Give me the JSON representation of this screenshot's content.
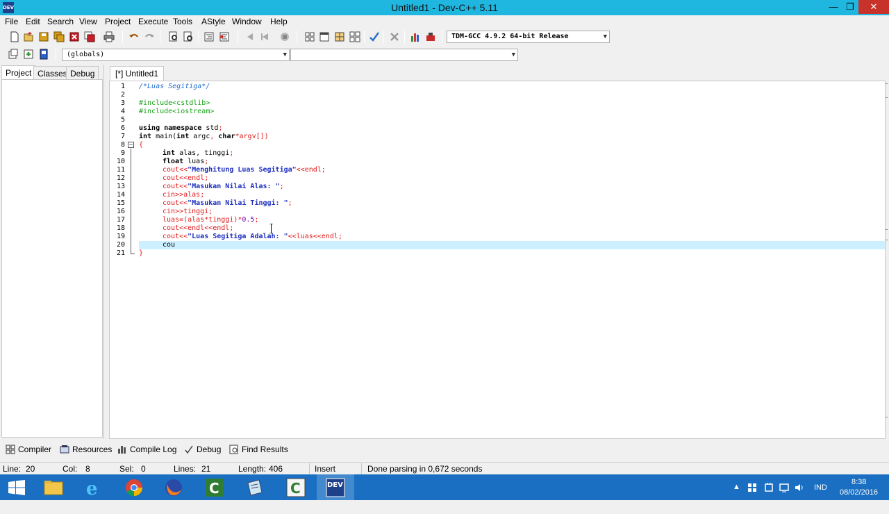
{
  "window": {
    "title": "Untitled1 - Dev-C++ 5.11",
    "icon_text": "DEV",
    "minimize_glyph": "—",
    "restore_glyph": "❐",
    "close_glyph": "✕"
  },
  "menu": [
    "File",
    "Edit",
    "Search",
    "View",
    "Project",
    "Execute",
    "Tools",
    "AStyle",
    "Window",
    "Help"
  ],
  "toolbar": {
    "compiler_select": "TDM-GCC 4.9.2 64-bit Release",
    "scope_select": "(globals)",
    "function_select": ""
  },
  "left_panel": {
    "tabs": [
      "Project",
      "Classes",
      "Debug"
    ],
    "active_tab": "Project"
  },
  "editor": {
    "tab_label": "[*] Untitled1",
    "current_line": 20,
    "lines": [
      {
        "n": "1"
      },
      {
        "n": "2"
      },
      {
        "n": "3"
      },
      {
        "n": "4"
      },
      {
        "n": "5"
      },
      {
        "n": "6"
      },
      {
        "n": "7"
      },
      {
        "n": "8"
      },
      {
        "n": "9"
      },
      {
        "n": "10"
      },
      {
        "n": "11"
      },
      {
        "n": "12"
      },
      {
        "n": "13"
      },
      {
        "n": "14"
      },
      {
        "n": "15"
      },
      {
        "n": "16"
      },
      {
        "n": "17"
      },
      {
        "n": "18"
      },
      {
        "n": "19"
      },
      {
        "n": "20"
      },
      {
        "n": "21"
      }
    ],
    "code": {
      "l1": "/*Luas Segitiga*/",
      "l3": "#include<cstdlib>",
      "l4": "#include<iostream>",
      "l6_kw": "using namespace",
      "l6_rest": " std",
      "l7_kw1": "int",
      "l7_a": " main(",
      "l7_kw2": "int",
      "l7_b": " argc",
      "l7_c": ", ",
      "l7_kw3": "char",
      "l7_d": "*argv[])",
      "l8": "{",
      "l9_kw": "int",
      "l9_rest": " alas, tinggi",
      "l10_kw": "float",
      "l10_rest": " luas",
      "l11_a": "cout<<",
      "l11_str": "\"Menghitung Luas Segitiga\"",
      "l11_b": "<<endl",
      "l12": "cout<<endl",
      "l13_a": "cout<<",
      "l13_str": "\"Masukan Nilai Alas: \"",
      "l14": "cin>>alas",
      "l15_a": "cout<<",
      "l15_str": "\"Masukan Nilai Tinggi: \"",
      "l16": "cin>>tinggi",
      "l17_a": "luas=(alas*tinggi)*",
      "l17_num": "0.5",
      "l18": "cout<<endl<<endl",
      "l19_a": "cout<<",
      "l19_str": "\"Luas Segitiga Adalah: \"",
      "l19_b": "<<luas<<endl",
      "l20": "cou",
      "l21": "}",
      "semi": ";"
    }
  },
  "bottom_tabs": [
    "Compiler",
    "Resources",
    "Compile Log",
    "Debug",
    "Find Results"
  ],
  "status": {
    "line_label": "Line:",
    "line_value": "20",
    "col_label": "Col:",
    "col_value": "8",
    "sel_label": "Sel:",
    "sel_value": "0",
    "lines_label": "Lines:",
    "lines_value": "21",
    "length_label": "Length:",
    "length_value": "406",
    "mode": "Insert",
    "message": "Done parsing in 0,672 seconds"
  },
  "taskbar": {
    "language": "IND",
    "time": "8:38",
    "date": "08/02/2016",
    "dev_label": "DEV"
  },
  "colors": {
    "titlebar": "#1fb6e0",
    "taskbar": "#1a6fc2",
    "current_line": "#ccf0ff"
  }
}
